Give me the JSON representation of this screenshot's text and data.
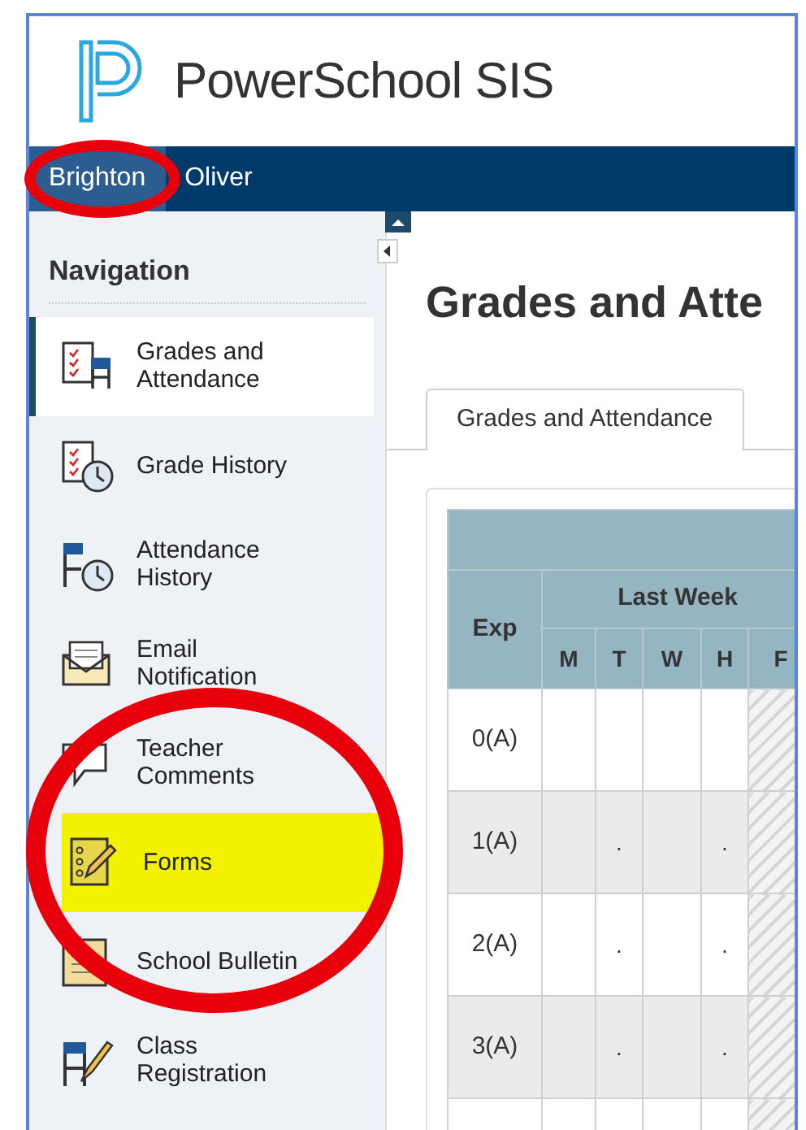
{
  "app": {
    "logo_text": "PowerSchool SIS"
  },
  "student_tabs": [
    {
      "label": "Brighton",
      "selected": true,
      "circled": true
    },
    {
      "label": "Oliver",
      "selected": false,
      "circled": false
    }
  ],
  "sidebar": {
    "title": "Navigation",
    "items": [
      {
        "label": "Grades and Attendance",
        "selected": true,
        "highlighted": false,
        "circled": false
      },
      {
        "label": "Grade History",
        "selected": false,
        "highlighted": false,
        "circled": false
      },
      {
        "label": "Attendance History",
        "selected": false,
        "highlighted": false,
        "circled": false
      },
      {
        "label": "Email Notification",
        "selected": false,
        "highlighted": false,
        "circled": false
      },
      {
        "label": "Teacher Comments",
        "selected": false,
        "highlighted": false,
        "circled": false
      },
      {
        "label": "Forms",
        "selected": false,
        "highlighted": true,
        "circled": true
      },
      {
        "label": "School Bulletin",
        "selected": false,
        "highlighted": false,
        "circled": false
      },
      {
        "label": "Class Registration",
        "selected": false,
        "highlighted": false,
        "circled": false
      }
    ]
  },
  "page": {
    "title": "Grades and Atte",
    "tabs": [
      {
        "label": "Grades and Attendance",
        "selected": true
      }
    ],
    "table": {
      "exp_header": "Exp",
      "group_header": "Last Week",
      "days": [
        {
          "label": "M",
          "shaded": false
        },
        {
          "label": "T",
          "shaded": false
        },
        {
          "label": "W",
          "shaded": false
        },
        {
          "label": "H",
          "shaded": false
        },
        {
          "label": "F",
          "shaded": true
        }
      ],
      "rows": [
        {
          "exp": "0(A)",
          "cells": [
            null,
            null,
            null,
            null,
            null
          ]
        },
        {
          "exp": "1(A)",
          "cells": [
            null,
            ".",
            null,
            ".",
            null
          ]
        },
        {
          "exp": "2(A)",
          "cells": [
            null,
            ".",
            null,
            ".",
            null
          ]
        },
        {
          "exp": "3(A)",
          "cells": [
            null,
            ".",
            null,
            ".",
            null
          ]
        }
      ]
    }
  }
}
